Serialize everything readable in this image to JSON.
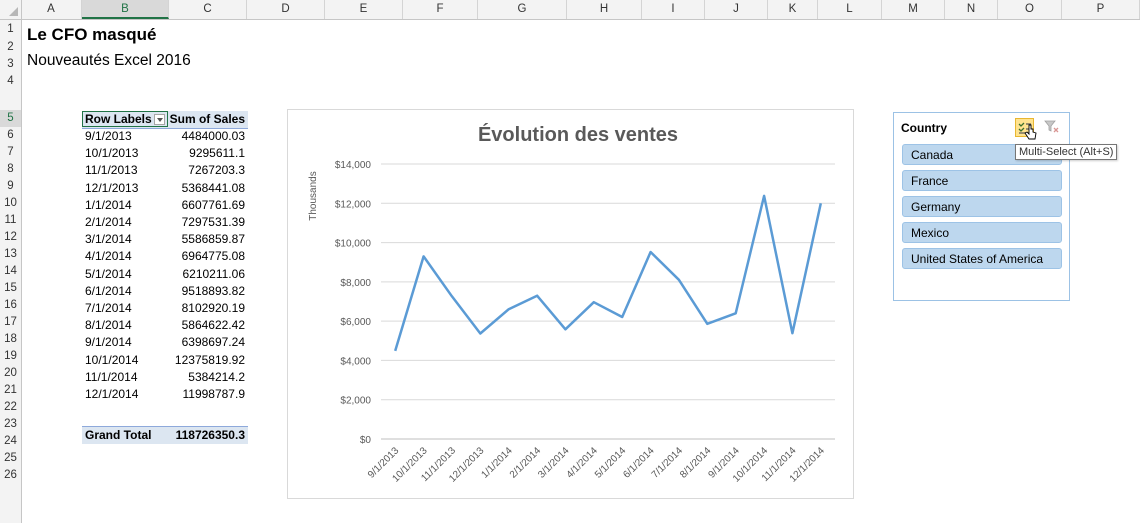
{
  "columns": [
    "A",
    "B",
    "C",
    "D",
    "E",
    "F",
    "G",
    "H",
    "I",
    "J",
    "K",
    "L",
    "M",
    "N",
    "O",
    "P"
  ],
  "rows": [
    "1",
    "2",
    "3",
    "4",
    "5",
    "6",
    "7",
    "8",
    "9",
    "10",
    "11",
    "12",
    "13",
    "14",
    "15",
    "16",
    "17",
    "18",
    "19",
    "20",
    "21",
    "22",
    "23",
    "24",
    "25",
    "26"
  ],
  "sheet": {
    "title": "Le CFO masqué",
    "subtitle": "Nouveautés Excel 2016"
  },
  "pivot": {
    "header_label": "Row Labels",
    "header_value": "Sum of Sales",
    "rows": [
      {
        "label": "9/1/2013",
        "value": "4484000.03"
      },
      {
        "label": "10/1/2013",
        "value": "9295611.1"
      },
      {
        "label": "11/1/2013",
        "value": "7267203.3"
      },
      {
        "label": "12/1/2013",
        "value": "5368441.08"
      },
      {
        "label": "1/1/2014",
        "value": "6607761.69"
      },
      {
        "label": "2/1/2014",
        "value": "7297531.39"
      },
      {
        "label": "3/1/2014",
        "value": "5586859.87"
      },
      {
        "label": "4/1/2014",
        "value": "6964775.08"
      },
      {
        "label": "5/1/2014",
        "value": "6210211.06"
      },
      {
        "label": "6/1/2014",
        "value": "9518893.82"
      },
      {
        "label": "7/1/2014",
        "value": "8102920.19"
      },
      {
        "label": "8/1/2014",
        "value": "5864622.42"
      },
      {
        "label": "9/1/2014",
        "value": "6398697.24"
      },
      {
        "label": "10/1/2014",
        "value": "12375819.92"
      },
      {
        "label": "11/1/2014",
        "value": "5384214.2"
      },
      {
        "label": "12/1/2014",
        "value": "11998787.9"
      }
    ],
    "total_label": "Grand Total",
    "total_value": "118726350.3"
  },
  "chart_data": {
    "type": "line",
    "title": "Évolution des ventes",
    "ylabel": "Thousands",
    "xlabel": "",
    "categories": [
      "9/1/2013",
      "10/1/2013",
      "11/1/2013",
      "12/1/2013",
      "1/1/2014",
      "2/1/2014",
      "3/1/2014",
      "4/1/2014",
      "5/1/2014",
      "6/1/2014",
      "7/1/2014",
      "8/1/2014",
      "9/1/2014",
      "10/1/2014",
      "11/1/2014",
      "12/1/2014"
    ],
    "values": [
      4484.0,
      9295.6,
      7267.2,
      5368.4,
      6607.8,
      7297.5,
      5586.9,
      6964.8,
      6210.2,
      9518.9,
      8102.9,
      5864.6,
      6398.7,
      12375.8,
      5384.2,
      11998.8
    ],
    "ytick_labels": [
      "$0",
      "$2,000",
      "$4,000",
      "$6,000",
      "$8,000",
      "$10,000",
      "$12,000",
      "$14,000"
    ],
    "ylim": [
      0,
      14000
    ],
    "grid": true,
    "legend": "none",
    "line_color": "#5b9bd5"
  },
  "slicer": {
    "header": "Country",
    "items": [
      "Canada",
      "France",
      "Germany",
      "Mexico",
      "United States of America"
    ],
    "tooltip": "Multi-Select (Alt+S)"
  },
  "colors": {
    "accent": "#217346",
    "pivot_header": "#dce6f1",
    "slicer_item": "#bdd7ee"
  }
}
